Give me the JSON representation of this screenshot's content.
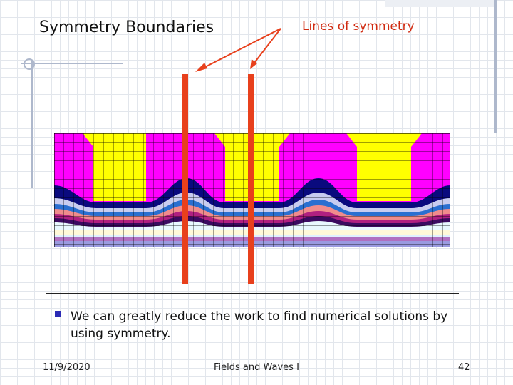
{
  "slide": {
    "title": "Symmetry Boundaries",
    "callout": "Lines of symmetry",
    "bullet": "We can greatly reduce the work to find numerical solutions by using symmetry.",
    "footer": {
      "date": "11/9/2020",
      "center": "Fields and Waves I",
      "page": "42"
    }
  },
  "colors": {
    "background": "#ffffff",
    "callout_red": "#d02a10",
    "symmetry_line": "#e8401c",
    "magenta": "#ff00ff",
    "yellow": "#ffff00",
    "navy": "#0a0a7e",
    "bullet": "#2b2bb5"
  }
}
